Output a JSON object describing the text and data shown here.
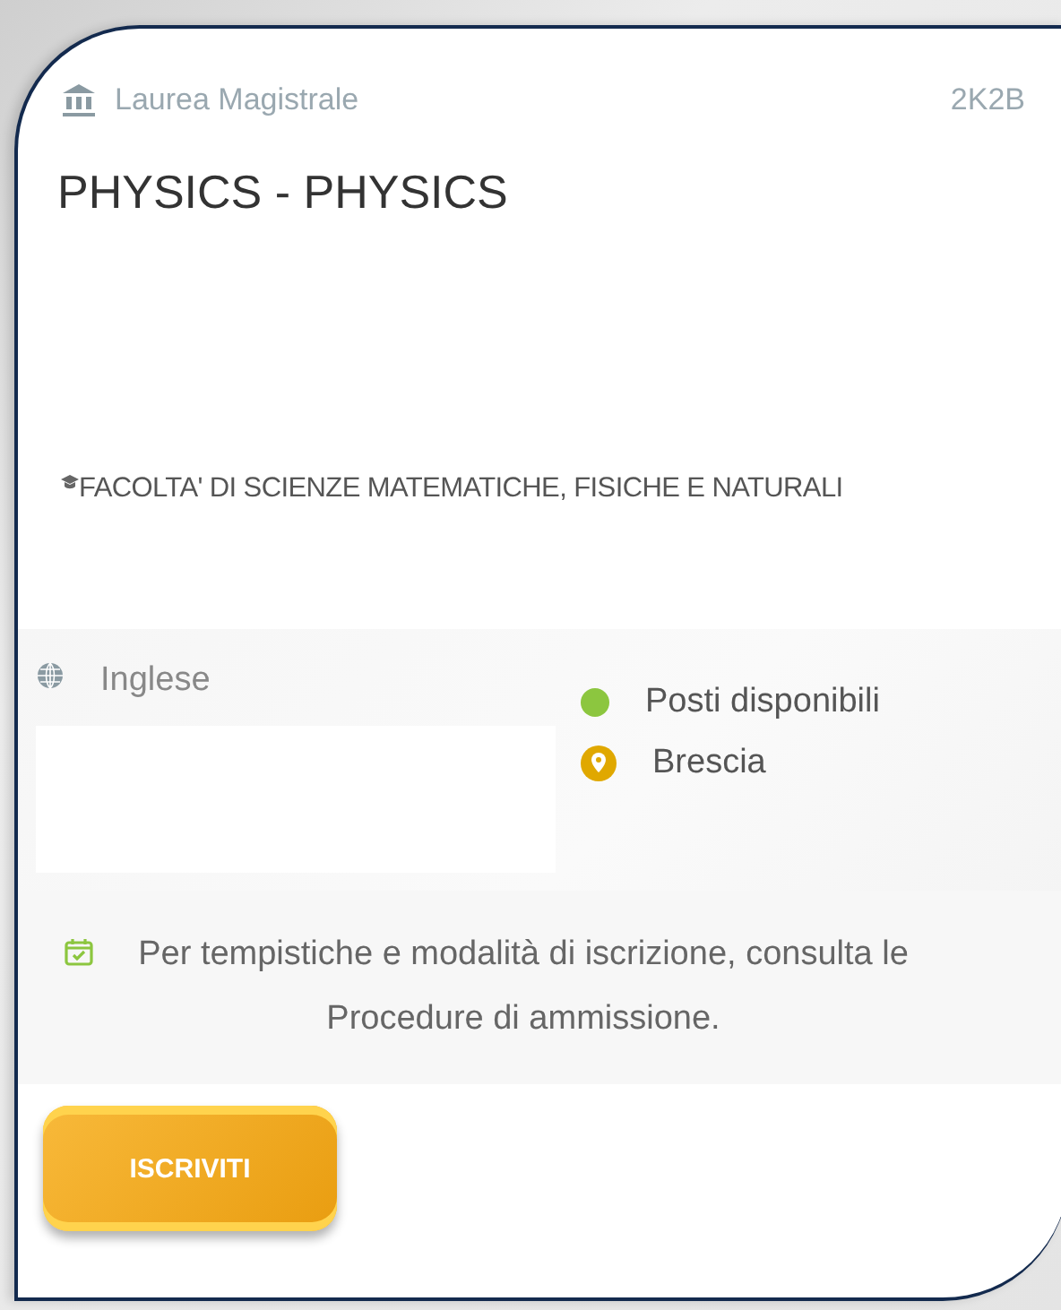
{
  "card": {
    "degree_type": "Laurea Magistrale",
    "code": "2K2B",
    "title": "PHYSICS - PHYSICS",
    "faculty": "FACOLTA' DI SCIENZE MATEMATICHE, FISICHE E NATURALI",
    "language": "Inglese",
    "status": {
      "label": "Posti disponibili",
      "color": "#8cc63f"
    },
    "location": "Brescia",
    "note": "Per tempistiche e modalità di iscrizione, consulta le Procedure di ammissione.",
    "button": "ISCRIVITI"
  }
}
